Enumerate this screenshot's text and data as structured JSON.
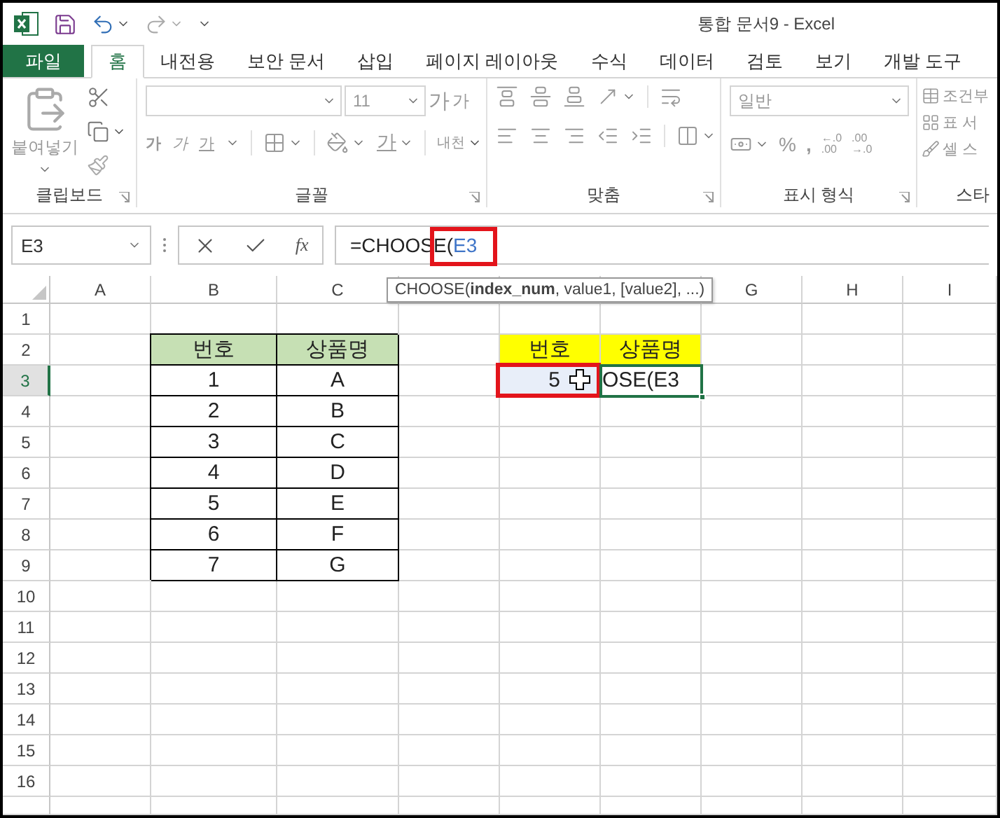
{
  "title_bar": {
    "title": "통합 문서9 - Excel"
  },
  "tabs": [
    {
      "label": "파일",
      "kind": "file",
      "selected": false
    },
    {
      "label": "홈",
      "kind": "tab",
      "selected": true
    },
    {
      "label": "내전용",
      "kind": "tab",
      "selected": false
    },
    {
      "label": "보안 문서",
      "kind": "tab",
      "selected": false
    },
    {
      "label": "삽입",
      "kind": "tab",
      "selected": false
    },
    {
      "label": "페이지 레이아웃",
      "kind": "tab",
      "selected": false
    },
    {
      "label": "수식",
      "kind": "tab",
      "selected": false
    },
    {
      "label": "데이터",
      "kind": "tab",
      "selected": false
    },
    {
      "label": "검토",
      "kind": "tab",
      "selected": false
    },
    {
      "label": "보기",
      "kind": "tab",
      "selected": false
    },
    {
      "label": "개발 도구",
      "kind": "tab",
      "selected": false
    }
  ],
  "ribbon": {
    "groups": [
      {
        "kind": "clipboard",
        "label": "클립보드",
        "paste_label": "붙여넣기"
      },
      {
        "kind": "font",
        "label": "글꼴",
        "font_size": "11",
        "grow": "가",
        "shrink": "가",
        "bold": "가",
        "italic": "가",
        "underline": "가",
        "font_color": "가",
        "phonetic": "내천"
      },
      {
        "kind": "alignment",
        "label": "맞춤"
      },
      {
        "kind": "number",
        "label": "표시 형식",
        "format": "일반",
        "percent": "%",
        "comma": ",",
        "increase_decimal": [
          "←.0",
          ".00"
        ],
        "decrease_decimal": [
          ".00",
          "→.0"
        ]
      },
      {
        "kind": "styles",
        "label": "스타",
        "items": [
          "조건부",
          "표 서",
          "셀 스"
        ]
      }
    ]
  },
  "formula_bar": {
    "name_box": "E3",
    "fx": "fx",
    "formula": [
      {
        "text": "=CHOOSE(",
        "kind": "plain"
      },
      {
        "text": "E3",
        "kind": "ref"
      }
    ]
  },
  "tooltip": "CHOOSE(**index_num**, value1, [value2], ...)",
  "sheet": {
    "columns": [
      "A",
      "B",
      "C",
      null,
      null,
      null,
      "G",
      "H",
      "I"
    ],
    "rows": [
      {
        "header": "1",
        "selected": false,
        "cells": [
          null,
          null,
          null,
          null,
          null,
          null,
          null,
          null,
          null
        ]
      },
      {
        "header": "2",
        "selected": false,
        "cells": [
          null,
          {
            "text": "번호",
            "kind": "green-header"
          },
          {
            "text": "상품명",
            "kind": "green-header"
          },
          null,
          {
            "text": "번호",
            "kind": "yellow-header"
          },
          {
            "text": "상품명",
            "kind": "yellow-header"
          },
          null,
          null,
          null
        ]
      },
      {
        "header": "3",
        "selected": true,
        "cells": [
          null,
          {
            "text": "1",
            "kind": "boxed"
          },
          {
            "text": "A",
            "kind": "boxed"
          },
          null,
          {
            "text": "5",
            "kind": "selected"
          },
          {
            "text": "OSE(E3",
            "kind": "active"
          },
          null,
          null,
          null
        ]
      },
      {
        "header": "4",
        "selected": false,
        "cells": [
          null,
          {
            "text": "2",
            "kind": "boxed"
          },
          {
            "text": "B",
            "kind": "boxed"
          },
          null,
          null,
          null,
          null,
          null,
          null
        ]
      },
      {
        "header": "5",
        "selected": false,
        "cells": [
          null,
          {
            "text": "3",
            "kind": "boxed"
          },
          {
            "text": "C",
            "kind": "boxed"
          },
          null,
          null,
          null,
          null,
          null,
          null
        ]
      },
      {
        "header": "6",
        "selected": false,
        "cells": [
          null,
          {
            "text": "4",
            "kind": "boxed"
          },
          {
            "text": "D",
            "kind": "boxed"
          },
          null,
          null,
          null,
          null,
          null,
          null
        ]
      },
      {
        "header": "7",
        "selected": false,
        "cells": [
          null,
          {
            "text": "5",
            "kind": "boxed"
          },
          {
            "text": "E",
            "kind": "boxed"
          },
          null,
          null,
          null,
          null,
          null,
          null
        ]
      },
      {
        "header": "8",
        "selected": false,
        "cells": [
          null,
          {
            "text": "6",
            "kind": "boxed"
          },
          {
            "text": "F",
            "kind": "boxed"
          },
          null,
          null,
          null,
          null,
          null,
          null
        ]
      },
      {
        "header": "9",
        "selected": false,
        "cells": [
          null,
          {
            "text": "7",
            "kind": "boxed"
          },
          {
            "text": "G",
            "kind": "boxed"
          },
          null,
          null,
          null,
          null,
          null,
          null
        ]
      },
      {
        "header": "10",
        "selected": false,
        "cells": [
          null,
          null,
          null,
          null,
          null,
          null,
          null,
          null,
          null
        ]
      },
      {
        "header": "11",
        "selected": false,
        "cells": [
          null,
          null,
          null,
          null,
          null,
          null,
          null,
          null,
          null
        ]
      },
      {
        "header": "12",
        "selected": false,
        "cells": [
          null,
          null,
          null,
          null,
          null,
          null,
          null,
          null,
          null
        ]
      },
      {
        "header": "13",
        "selected": false,
        "cells": [
          null,
          null,
          null,
          null,
          null,
          null,
          null,
          null,
          null
        ]
      },
      {
        "header": "14",
        "selected": false,
        "cells": [
          null,
          null,
          null,
          null,
          null,
          null,
          null,
          null,
          null
        ]
      },
      {
        "header": "15",
        "selected": false,
        "cells": [
          null,
          null,
          null,
          null,
          null,
          null,
          null,
          null,
          null
        ]
      },
      {
        "header": "16",
        "selected": false,
        "cells": [
          null,
          null,
          null,
          null,
          null,
          null,
          null,
          null,
          null
        ]
      }
    ]
  }
}
